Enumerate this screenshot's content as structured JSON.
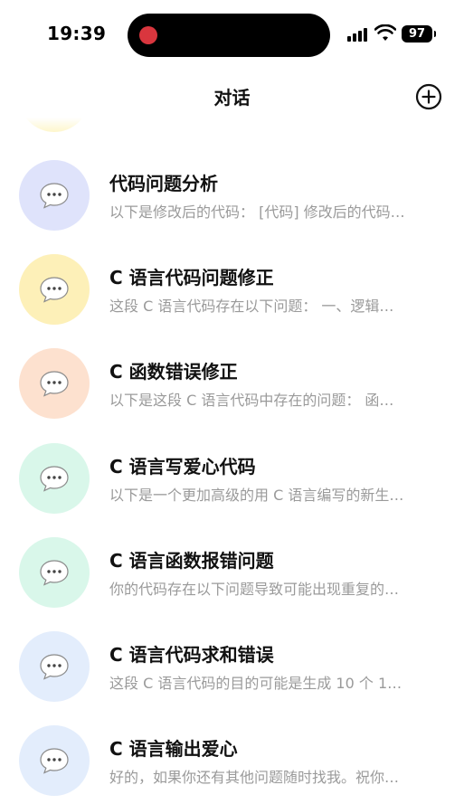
{
  "status_bar": {
    "time": "19:39",
    "battery": "97"
  },
  "header": {
    "title": "对话"
  },
  "partial_item": {
    "avatar_color": "#fdf3b8"
  },
  "conversations": [
    {
      "title": "代码问题分析",
      "preview": "以下是修改后的代码：  [代码] 修改后的代码…",
      "avatar_color": "#dfe3fb"
    },
    {
      "title": "C 语言代码问题修正",
      "preview": "这段 C 语言代码存在以下问题：  一、逻辑…",
      "avatar_color": "#fdf0b8"
    },
    {
      "title": "C 函数错误修正",
      "preview": "以下是这段 C 语言代码中存在的问题：  函…",
      "avatar_color": "#fde1cf"
    },
    {
      "title": "C 语言写爱心代码",
      "preview": "以下是一个更加高级的用 C 语言编写的新生…",
      "avatar_color": "#d9f7ea"
    },
    {
      "title": "C 语言函数报错问题",
      "preview": "你的代码存在以下问题导致可能出现重复的…",
      "avatar_color": "#d9f7ea"
    },
    {
      "title": "C 语言代码求和错误",
      "preview": "这段 C 语言代码的目的可能是生成 10 个 1…",
      "avatar_color": "#e3edfc"
    },
    {
      "title": "C 语言输出爱心",
      "preview": "好的，如果你还有其他问题随时找我。祝你…",
      "avatar_color": "#e3edfc"
    }
  ],
  "colors": {
    "accent": "#d9363e",
    "text": "#111111",
    "muted": "#9a9a9a"
  }
}
